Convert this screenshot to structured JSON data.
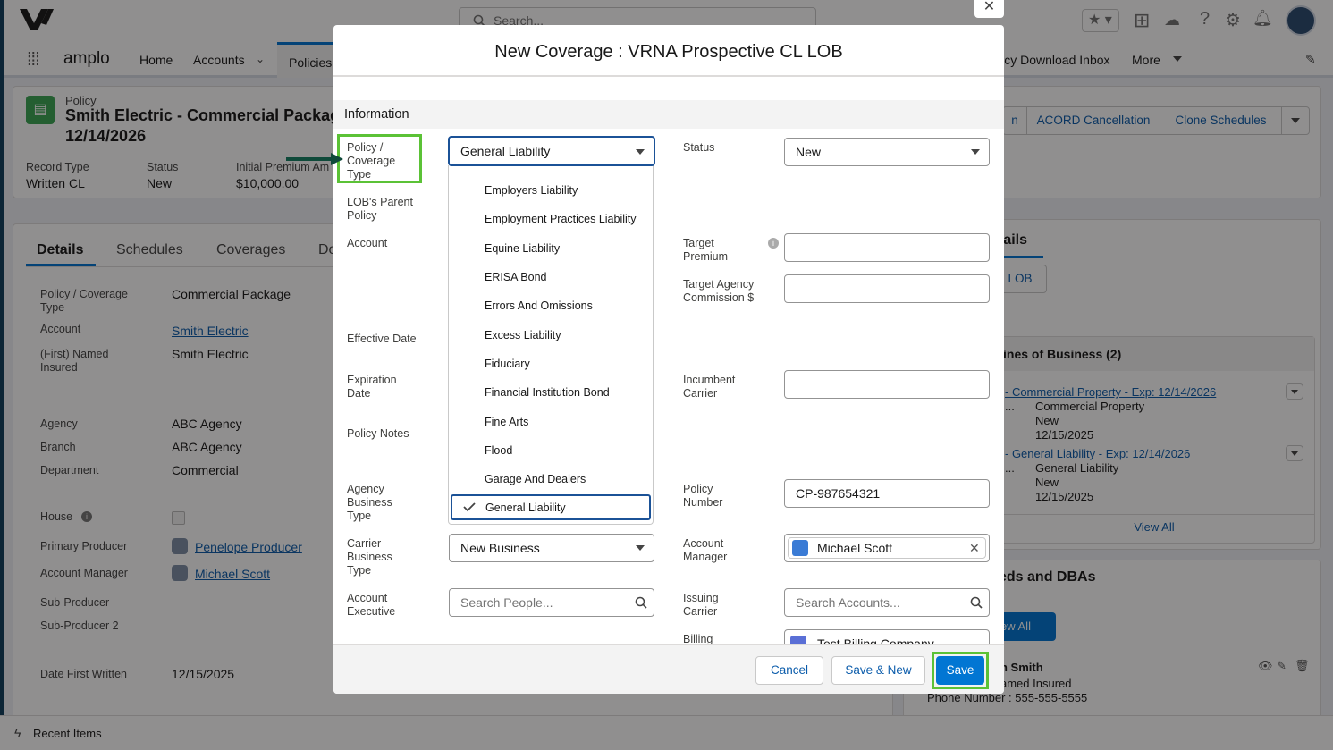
{
  "header": {
    "search_placeholder": "Search...",
    "app_name": "amplo"
  },
  "nav": {
    "items": [
      "Home",
      "Accounts",
      "Policies"
    ],
    "right_items": [
      "licy Download Inbox",
      "More"
    ]
  },
  "record": {
    "object": "Policy",
    "title_line1": "Smith Electric - Commercial Packag",
    "title_line2": "12/14/2026",
    "fields": [
      {
        "label": "Record Type",
        "value": "Written CL"
      },
      {
        "label": "Status",
        "value": "New"
      },
      {
        "label": "Initial Premium Am",
        "value": "$10,000.00"
      }
    ],
    "actions": [
      "n",
      "ACORD Cancellation",
      "Clone Schedules"
    ]
  },
  "tabs": [
    "Details",
    "Schedules",
    "Coverages",
    "Do"
  ],
  "details": [
    {
      "label": "Policy / Coverage Type",
      "value": "Commercial Package"
    },
    {
      "label": "Account",
      "value": "Smith Electric"
    },
    {
      "label": "(First) Named Insured",
      "value": "Smith Electric"
    },
    {
      "label": "Agency",
      "value": "ABC Agency"
    },
    {
      "label": "Branch",
      "value": "ABC Agency"
    },
    {
      "label": "Department",
      "value": "Commercial"
    },
    {
      "label": "House",
      "value": ""
    },
    {
      "label": "Primary Producer",
      "value": "Penelope Producer"
    },
    {
      "label": "Account Manager",
      "value": "Michael Scott"
    },
    {
      "label": "Sub-Producer",
      "value": ""
    },
    {
      "label": "Sub-Producer 2",
      "value": ""
    },
    {
      "label": "Date First Written",
      "value": "12/15/2025"
    }
  ],
  "right_panel": {
    "heading": "tails",
    "lob_button": "LOB",
    "lines_title": "ines of Business (2)",
    "lines": [
      {
        "link": "- Commercial Property - Exp: 12/14/2026",
        "short": "...",
        "type": "Commercial Property",
        "status": "New",
        "date": "12/15/2025"
      },
      {
        "link": "- General Liability - Exp: 12/14/2026",
        "short": "...",
        "type": "General Liability",
        "status": "New",
        "date": "12/15/2025"
      }
    ],
    "view_all": "View All",
    "insureds_title": "eds and DBAs",
    "view_all_2": "ew All",
    "person_name": "n Smith",
    "person_role": "amed Insured",
    "person_phone": "Phone Number : 555-555-5555"
  },
  "modal": {
    "title": "New Coverage : VRNA Prospective CL LOB",
    "section": "Information",
    "labels_left": {
      "coverage_type": "Policy / Coverage Type",
      "lob_parent": "LOB's Parent Policy",
      "account": "Account",
      "effective": "Effective Date",
      "expiration": "Expiration Date",
      "notes": "Policy Notes",
      "agency_business_type": "Agency Business Type",
      "carrier_business_type": "Carrier Business Type",
      "account_executive": "Account Executive"
    },
    "labels_right": {
      "status": "Status",
      "target_premium": "Target Premium",
      "target_commission": "Target Agency Commission $",
      "incumbent": "Incumbent Carrier",
      "policy_number": "Policy Number",
      "account_manager": "Account Manager",
      "issuing_carrier": "Issuing Carrier",
      "billing": "Billing"
    },
    "coverage_type_value": "General Liability",
    "status_value": "New",
    "policy_number_value": "CP-987654321",
    "account_manager_value": "Michael Scott",
    "carrier_business_type_value": "New Business",
    "account_executive_placeholder": "Search People...",
    "issuing_carrier_placeholder": "Search Accounts...",
    "billing_value": "Test Billing Company",
    "dropdown_options": [
      "Employers Liability",
      "Employment Practices Liability",
      "Equine Liability",
      "ERISA Bond",
      "Errors And Omissions",
      "Excess Liability",
      "Fiduciary",
      "Financial Institution Bond",
      "Fine Arts",
      "Flood",
      "Garage And Dealers",
      "General Liability"
    ],
    "selected_option": "General Liability",
    "buttons": {
      "cancel": "Cancel",
      "save_new": "Save & New",
      "save": "Save"
    }
  },
  "footer": {
    "recent": "Recent Items"
  },
  "colors": {
    "accent": "#0176d3",
    "highlight": "#5bc236",
    "policy_icon": "#3ba755"
  }
}
